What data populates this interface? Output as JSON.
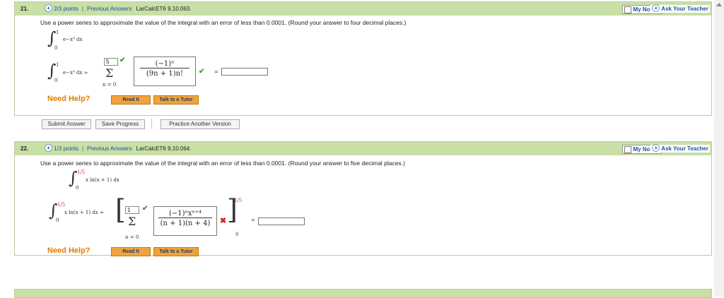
{
  "q21": {
    "number": "21.",
    "points": "2/3 points",
    "previous": "Previous Answers",
    "code": "LarCalcET6 9.10.063.",
    "my_notes": "My Notes",
    "ask": "Ask Your Teacher",
    "prompt": "Use a power series to approximate the value of the integral with an error of less than 0.0001. (Round your answer to four decimal places.)",
    "integrand": "e−x⁹ dx",
    "upper": "1",
    "lower": "0",
    "lhs": "e−x⁹ dx ≈",
    "sum_upper_value": "5",
    "sum_lower": "n = 0",
    "frac_num": "(−1)ⁿ",
    "frac_den": "(9n + 1)n!",
    "equals": "=",
    "answer": "",
    "need_help": "Need Help?",
    "read_it": "Read It",
    "talk_tutor": "Talk to a Tutor",
    "submit": "Submit Answer",
    "save": "Save Progress",
    "practice": "Practice Another Version"
  },
  "q22": {
    "number": "22.",
    "points": "1/3 points",
    "previous": "Previous Answers",
    "code": "LarCalcET6 9.10.064.",
    "my_notes": "My Notes",
    "ask": "Ask Your Teacher",
    "prompt": "Use a power series to approximate the value of the integral with an error of less than 0.0001. (Round your answer to five decimal places.)",
    "integrand": "x ln(x + 1) dx",
    "upper": "1/5",
    "lower": "0",
    "lhs": "x ln(x + 1) dx ≈",
    "sum_upper_value": "1",
    "sum_lower": "n = 0",
    "frac_num": "(−1)ⁿxⁿ⁺⁴",
    "frac_den": "(n + 1)(n + 4)",
    "eval_upper": "1/5",
    "eval_lower": "0",
    "equals": "=",
    "answer": "",
    "need_help": "Need Help?",
    "read_it": "Read It",
    "talk_tutor": "Talk to a Tutor"
  }
}
